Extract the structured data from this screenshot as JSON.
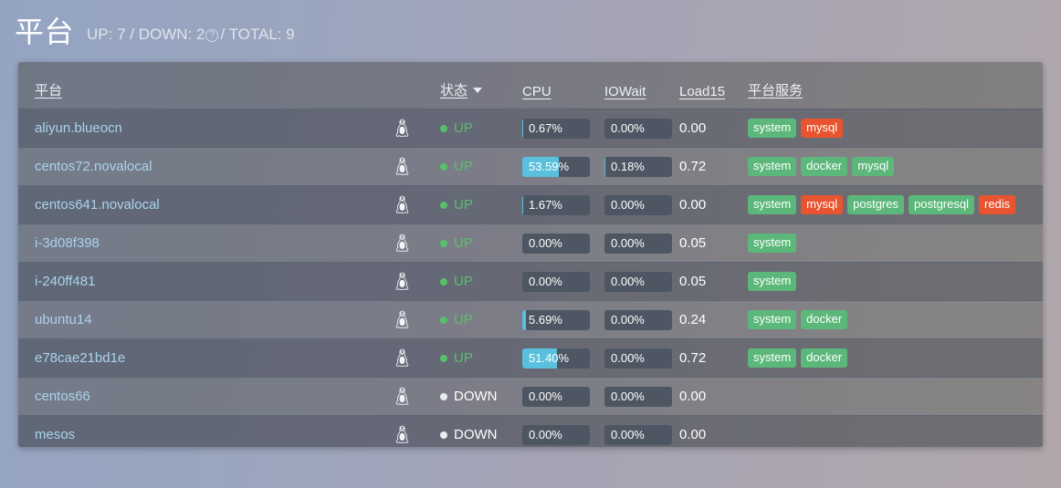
{
  "header": {
    "title": "平台",
    "summary_prefix": "UP: 7 / DOWN: 2",
    "help_glyph": "?",
    "summary_suffix": " / TOTAL: 9",
    "up_count": 7,
    "down_count": 2,
    "total_count": 9
  },
  "table": {
    "columns": [
      {
        "key": "host",
        "label": "平台",
        "sorted": false
      },
      {
        "key": "os",
        "label": "",
        "sorted": false
      },
      {
        "key": "state",
        "label": "状态",
        "sorted": true
      },
      {
        "key": "cpu",
        "label": "CPU",
        "sorted": false
      },
      {
        "key": "io",
        "label": "IOWait",
        "sorted": false
      },
      {
        "key": "load",
        "label": "Load15",
        "sorted": false
      },
      {
        "key": "svc",
        "label": "平台服务",
        "sorted": false
      }
    ],
    "rows": [
      {
        "host": "aliyun.blueocn",
        "os_icon": "tux-icon",
        "state": "UP",
        "cpu_label": "0.67%",
        "cpu_pct": 0.67,
        "io_label": "0.00%",
        "io_pct": 0.0,
        "load": "0.00",
        "services": [
          {
            "name": "system",
            "color": "green"
          },
          {
            "name": "mysql",
            "color": "red"
          }
        ]
      },
      {
        "host": "centos72.novalocal",
        "os_icon": "tux-icon",
        "state": "UP",
        "cpu_label": "53.59%",
        "cpu_pct": 53.59,
        "io_label": "0.18%",
        "io_pct": 0.18,
        "load": "0.72",
        "services": [
          {
            "name": "system",
            "color": "green"
          },
          {
            "name": "docker",
            "color": "green"
          },
          {
            "name": "mysql",
            "color": "green"
          }
        ]
      },
      {
        "host": "centos641.novalocal",
        "os_icon": "tux-icon",
        "state": "UP",
        "cpu_label": "1.67%",
        "cpu_pct": 1.67,
        "io_label": "0.00%",
        "io_pct": 0.0,
        "load": "0.00",
        "services": [
          {
            "name": "system",
            "color": "green"
          },
          {
            "name": "mysql",
            "color": "red"
          },
          {
            "name": "postgres",
            "color": "green"
          },
          {
            "name": "postgresql",
            "color": "green"
          },
          {
            "name": "redis",
            "color": "red"
          }
        ]
      },
      {
        "host": "i-3d08f398",
        "os_icon": "tux-icon",
        "state": "UP",
        "cpu_label": "0.00%",
        "cpu_pct": 0.0,
        "io_label": "0.00%",
        "io_pct": 0.0,
        "load": "0.05",
        "services": [
          {
            "name": "system",
            "color": "green"
          }
        ]
      },
      {
        "host": "i-240ff481",
        "os_icon": "tux-icon",
        "state": "UP",
        "cpu_label": "0.00%",
        "cpu_pct": 0.0,
        "io_label": "0.00%",
        "io_pct": 0.0,
        "load": "0.05",
        "services": [
          {
            "name": "system",
            "color": "green"
          }
        ]
      },
      {
        "host": "ubuntu14",
        "os_icon": "tux-icon",
        "state": "UP",
        "cpu_label": "5.69%",
        "cpu_pct": 5.69,
        "io_label": "0.00%",
        "io_pct": 0.0,
        "load": "0.24",
        "services": [
          {
            "name": "system",
            "color": "green"
          },
          {
            "name": "docker",
            "color": "green"
          }
        ]
      },
      {
        "host": "e78cae21bd1e",
        "os_icon": "tux-icon",
        "state": "UP",
        "cpu_label": "51.40%",
        "cpu_pct": 51.4,
        "io_label": "0.00%",
        "io_pct": 0.0,
        "load": "0.72",
        "services": [
          {
            "name": "system",
            "color": "green"
          },
          {
            "name": "docker",
            "color": "green"
          }
        ]
      },
      {
        "host": "centos66",
        "os_icon": "tux-icon",
        "state": "DOWN",
        "cpu_label": "0.00%",
        "cpu_pct": 0.0,
        "io_label": "0.00%",
        "io_pct": 0.0,
        "load": "0.00",
        "services": []
      },
      {
        "host": "mesos",
        "os_icon": "tux-icon",
        "state": "DOWN",
        "cpu_label": "0.00%",
        "cpu_pct": 0.0,
        "io_label": "0.00%",
        "io_pct": 0.0,
        "load": "0.00",
        "services": []
      }
    ]
  },
  "colors": {
    "tag_green": "#5cb87a",
    "tag_red": "#e8542f",
    "status_up": "#58c06a",
    "status_down": "#e8ecf1",
    "bar_fill": "#5bc0de",
    "bar_track": "#4e5663",
    "link": "#a9d4ec"
  }
}
